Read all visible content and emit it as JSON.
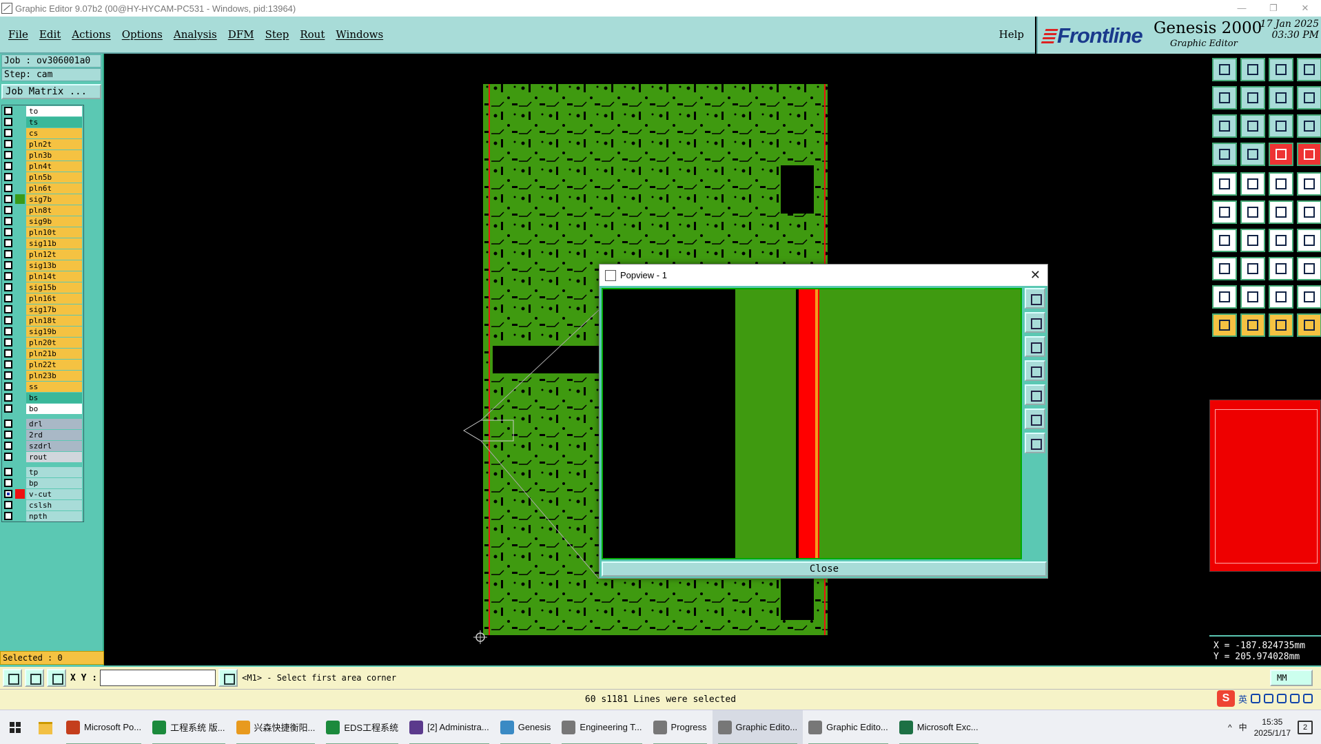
{
  "window": {
    "title": "Graphic Editor 9.07b2 (00@HY-HYCAM-PC531 - Windows, pid:13964)",
    "controls": [
      "—",
      "❐",
      "✕"
    ]
  },
  "menu": {
    "items": [
      "File",
      "Edit",
      "Actions",
      "Options",
      "Analysis",
      "DFM",
      "Step",
      "Rout",
      "Windows"
    ],
    "help": "Help"
  },
  "brand": {
    "logo": "Frontline",
    "product": "Genesis 2000",
    "subtitle": "Graphic Editor",
    "date": "17 Jan 2025",
    "time": "03:30 PM"
  },
  "job": {
    "job_label": "Job : ov306001a0",
    "step_label": "Step: cam",
    "matrix_button": "Job Matrix ..."
  },
  "layers": {
    "board": [
      {
        "name": "to",
        "color": "#ffffff"
      },
      {
        "name": "ts",
        "color": "#3ab89a"
      },
      {
        "name": "cs",
        "color": "#f5c242"
      },
      {
        "name": "pln2t",
        "color": "#f5c242"
      },
      {
        "name": "pln3b",
        "color": "#f5c242"
      },
      {
        "name": "pln4t",
        "color": "#f5c242"
      },
      {
        "name": "pln5b",
        "color": "#f5c242"
      },
      {
        "name": "pln6t",
        "color": "#f5c242"
      },
      {
        "name": "sig7b",
        "color": "#f5c242",
        "swatch": "#3a9a1a"
      },
      {
        "name": "pln8t",
        "color": "#f5c242"
      },
      {
        "name": "sig9b",
        "color": "#f5c242"
      },
      {
        "name": "pln10t",
        "color": "#f5c242"
      },
      {
        "name": "sig11b",
        "color": "#f5c242"
      },
      {
        "name": "pln12t",
        "color": "#f5c242"
      },
      {
        "name": "sig13b",
        "color": "#f5c242"
      },
      {
        "name": "pln14t",
        "color": "#f5c242"
      },
      {
        "name": "sig15b",
        "color": "#f5c242"
      },
      {
        "name": "pln16t",
        "color": "#f5c242"
      },
      {
        "name": "sig17b",
        "color": "#f5c242"
      },
      {
        "name": "pln18t",
        "color": "#f5c242"
      },
      {
        "name": "sig19b",
        "color": "#f5c242"
      },
      {
        "name": "pln20t",
        "color": "#f5c242"
      },
      {
        "name": "pln21b",
        "color": "#f5c242"
      },
      {
        "name": "pln22t",
        "color": "#f5c242"
      },
      {
        "name": "pln23b",
        "color": "#f5c242"
      },
      {
        "name": "ss",
        "color": "#f5c242"
      },
      {
        "name": "bs",
        "color": "#3ab89a"
      },
      {
        "name": "bo",
        "color": "#ffffff"
      }
    ],
    "drill": [
      {
        "name": "drl",
        "color": "#a9b8c6"
      },
      {
        "name": "2rd",
        "color": "#a9b8c6"
      },
      {
        "name": "szdrl",
        "color": "#a9b8c6"
      },
      {
        "name": "rout",
        "color": "#d0d6dc"
      }
    ],
    "misc": [
      {
        "name": "tp",
        "color": "#a8dcd8"
      },
      {
        "name": "bp",
        "color": "#a8dcd8"
      },
      {
        "name": "v-cut",
        "color": "#a8dcd8",
        "swatch": "#e11",
        "checked": true
      },
      {
        "name": "cslsh",
        "color": "#a8dcd8"
      },
      {
        "name": "npth",
        "color": "#a8dcd8"
      }
    ]
  },
  "selected_label": "Selected : 0",
  "popview": {
    "title": "Popview - 1",
    "close_label": "Close"
  },
  "coords": {
    "x": "X = -187.824735mm",
    "y": "Y = 205.974028mm"
  },
  "command": {
    "xy_label": "X Y :",
    "xy_value": "",
    "prompt": "<M1> - Select first area corner",
    "units": "MM"
  },
  "status": "60 s1181 Lines were selected",
  "ime": {
    "s": "S",
    "lang": "英"
  },
  "taskbar": {
    "items": [
      {
        "label": "Microsoft Po...",
        "color": "#c43e1c"
      },
      {
        "label": "工程系统  版...",
        "color": "#1b8a3c"
      },
      {
        "label": "兴森快捷衡阳...",
        "color": "#e89a1e"
      },
      {
        "label": "EDS工程系统",
        "color": "#1b8a3c"
      },
      {
        "label": "[2] Administra...",
        "color": "#5b3a8c"
      },
      {
        "label": "Genesis",
        "color": "#3a8ac4"
      },
      {
        "label": "Engineering T...",
        "color": "#777777"
      },
      {
        "label": "Progress",
        "color": "#777777"
      },
      {
        "label": "Graphic Edito...",
        "color": "#777777",
        "active": true
      },
      {
        "label": "Graphic Edito...",
        "color": "#777777"
      },
      {
        "label": "Microsoft Exc...",
        "color": "#1d7044"
      }
    ],
    "tray_lang": "中",
    "time": "15:35",
    "date": "2025/1/17",
    "notifications": "2"
  }
}
